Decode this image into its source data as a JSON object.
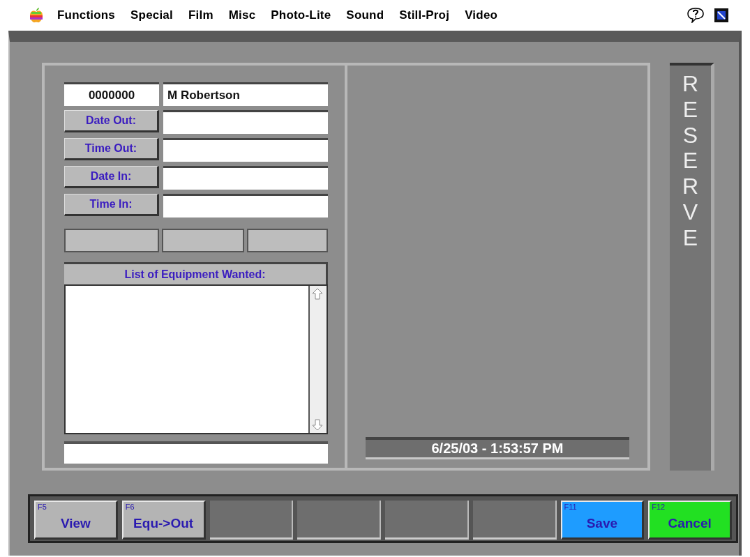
{
  "menu_bar": {
    "items": [
      "Functions",
      "Special",
      "Film",
      "Misc",
      "Photo-Lite",
      "Sound",
      "Still-Proj",
      "Video"
    ]
  },
  "record": {
    "id": "0000000",
    "name": "M Robertson"
  },
  "date_fields": [
    {
      "label": "Date Out:"
    },
    {
      "label": "Time Out:"
    },
    {
      "label": "Date In:"
    },
    {
      "label": "Time In:"
    }
  ],
  "equipment_list": {
    "header": "List of Equipment Wanted:"
  },
  "timestamp": "6/25/03 - 1:53:57 PM",
  "mode_label": "RESERVE",
  "function_keys": [
    {
      "kind": "key",
      "key": "F5",
      "label": "View",
      "color": "#b4b4b4"
    },
    {
      "kind": "key",
      "key": "F6",
      "label": "Equ->Out",
      "color": "#b4b4b4"
    },
    {
      "kind": "blank"
    },
    {
      "kind": "blank"
    },
    {
      "kind": "blank"
    },
    {
      "kind": "blank"
    },
    {
      "kind": "key",
      "key": "F11",
      "label": "Save",
      "color": "#1e9cff"
    },
    {
      "kind": "key",
      "key": "F12",
      "label": "Cancel",
      "color": "#22e022"
    }
  ]
}
